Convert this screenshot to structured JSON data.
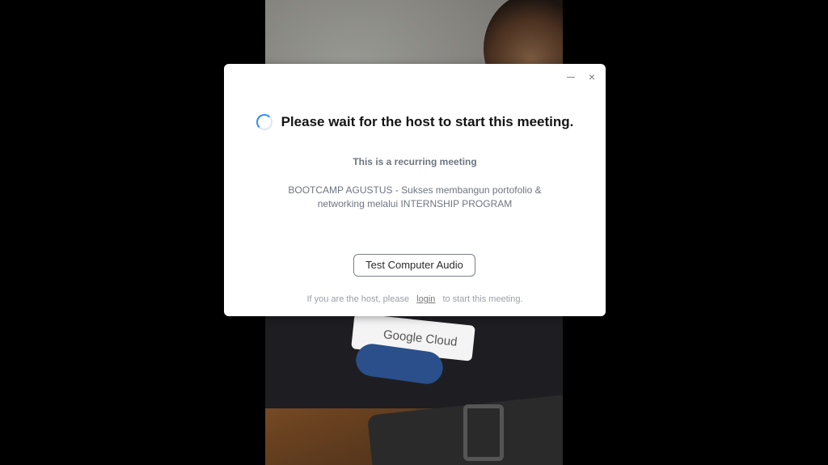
{
  "dialog": {
    "title": "Please wait for the host to start this meeting.",
    "recurring_label": "This is a recurring meeting",
    "topic_line1": "BOOTCAMP AGUSTUS - Sukses membangun portofolio &",
    "topic_line2": "networking melalui INTERNSHIP PROGRAM",
    "test_audio_button": "Test Computer Audio",
    "host_prefix": "If you are the host, please",
    "login_link": "login",
    "host_suffix": "to start this meeting.",
    "minimize_icon": "minimize-icon",
    "close_icon": "close-icon",
    "close_glyph": "×",
    "spinner_icon": "loading-spinner-icon",
    "accent_color": "#2d8cff"
  },
  "video": {
    "sticker_text": "Google Cloud"
  }
}
